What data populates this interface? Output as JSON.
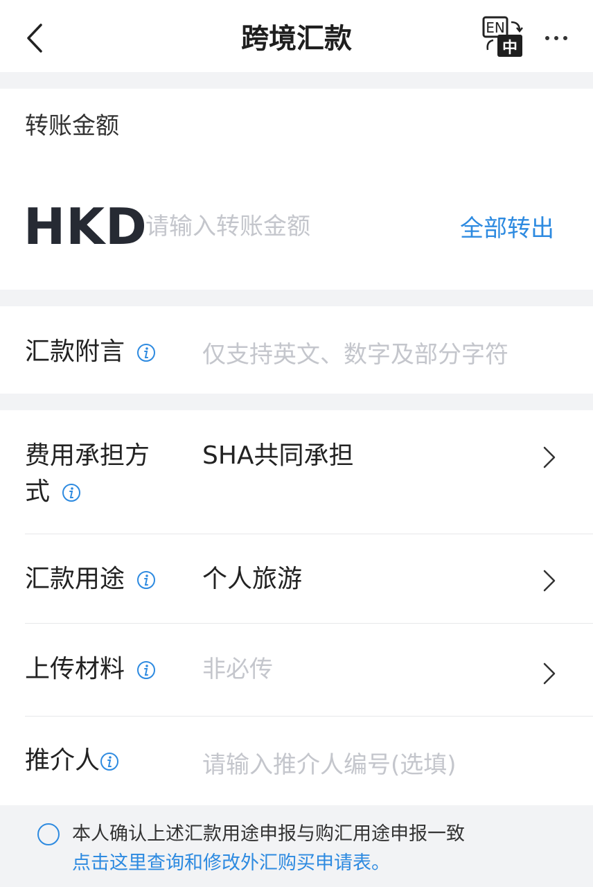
{
  "header": {
    "title": "跨境汇款",
    "back_icon": "chevron-left-icon",
    "language_toggle": {
      "top": "EN",
      "bottom": "中"
    },
    "more_icon": "more-dots-icon"
  },
  "amount": {
    "heading": "转账金额",
    "currency": "HKD",
    "placeholder": "请输入转账金额",
    "transfer_all_label": "全部转出"
  },
  "remark": {
    "label": "汇款附言",
    "placeholder": "仅支持英文、数字及部分字符"
  },
  "fee": {
    "label_line1": "费用承担方",
    "label_line2": "式",
    "value": "SHA共同承担"
  },
  "purpose": {
    "label": "汇款用途",
    "value": "个人旅游"
  },
  "upload": {
    "label": "上传材料",
    "value": "非必传"
  },
  "referrer": {
    "label": "推介人",
    "placeholder": "请输入推介人编号(选填)"
  },
  "footer": {
    "confirm_text": "本人确认上述汇款用途申报与购汇用途申报一致",
    "link_text": "点击这里查询和修改外汇购买申请表。"
  },
  "colors": {
    "accent": "#2d8ae0",
    "background": "#f2f3f5",
    "placeholder": "#c4c6cc"
  }
}
